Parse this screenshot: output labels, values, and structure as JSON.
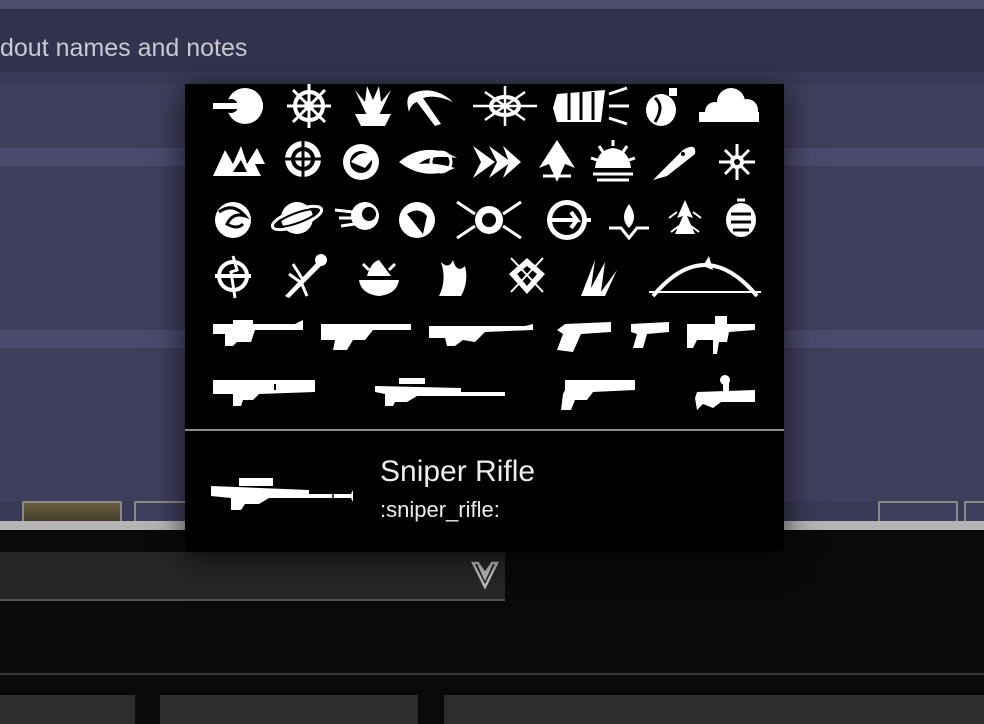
{
  "search": {
    "placeholder_visible": "dout names and notes"
  },
  "emoji_grid": {
    "rows": [
      [
        "class-emblem-icon",
        "void-burst-icon",
        "solar-flare-icon",
        "pickaxe-icon",
        "arc-splash-icon",
        "fist-icon",
        "grenade-icon",
        "cloud-icon"
      ],
      [
        "explosion-icon",
        "shield-ring-icon",
        "swirl-icon",
        "arc-orb-icon",
        "chevrons-icon",
        "up-arrow-icon",
        "sunrise-icon",
        "knife-icon",
        "star-burst-icon"
      ],
      [
        "vortex-icon",
        "planet-icon",
        "comet-icon",
        "hawk-icon",
        "target-icon",
        "arrow-circle-icon",
        "drop-icon",
        "tree-icon",
        "egg-icon"
      ],
      [
        "lightning-spear-icon",
        "branch-icon",
        "flame-bowl-icon",
        "fire-icon",
        "crystal-icon",
        "claw-icon",
        "bow-icon"
      ],
      [
        "auto-rifle-icon",
        "pulse-rifle-icon",
        "scout-rifle-icon",
        "hand-cannon-icon",
        "sidearm-icon",
        "smg-icon"
      ],
      [
        "shotgun-icon",
        "sniper-rifle-icon",
        "fusion-rifle-icon",
        "grenade-launcher-icon"
      ]
    ]
  },
  "preview": {
    "name": "Sniper Rifle",
    "code": ":sniper_rifle:",
    "icon": "sniper-rifle-icon"
  },
  "dropdown": {
    "icon": "vanguard-chevron-icon"
  },
  "colors": {
    "background": "#3b3a56",
    "popup": "#000000",
    "emoji": "#ffffff",
    "text": "#ececec"
  }
}
